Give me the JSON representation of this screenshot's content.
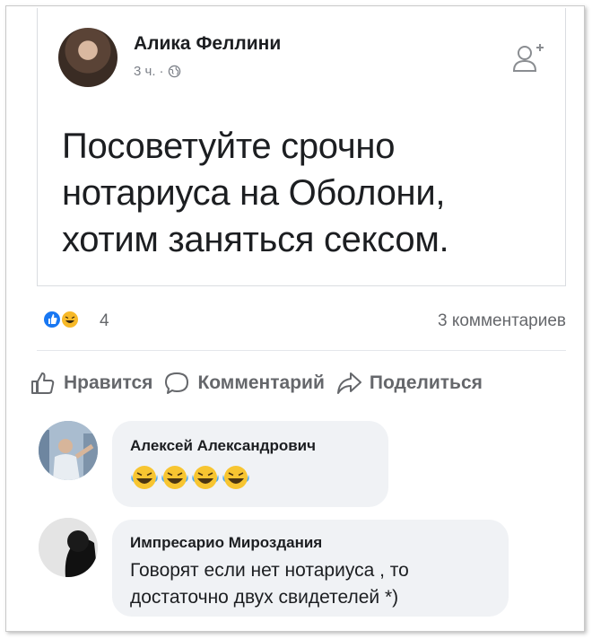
{
  "post": {
    "author": "Алика Феллини",
    "time": "3 ч.",
    "separator": "·",
    "text_lines": [
      "Посоветуйте срочно",
      "нотариуса на Оболони,",
      "хотим заняться сексом."
    ]
  },
  "reactions": {
    "count": "4",
    "comments": "3 комментариев"
  },
  "actions": {
    "like": "Нравится",
    "comment": "Комментарий",
    "share": "Поделиться"
  },
  "comments": [
    {
      "author": "Алексей Александрович",
      "emoji_count": 4
    },
    {
      "author": "Импресарио Мироздания",
      "text_lines": [
        "Говорят если нет нотариуса , то",
        "достаточно двух свидетелей *)"
      ]
    }
  ],
  "colors": {
    "like_blue": "#1877f2",
    "haha_yellow": "#f7b928",
    "muted": "#65676b",
    "bubble": "#f0f2f5"
  },
  "icons": [
    "globe-icon",
    "add-friend-icon",
    "like-reaction-icon",
    "haha-reaction-icon",
    "thumbs-up-icon",
    "comment-icon",
    "share-icon",
    "laughing-emoji-icon"
  ]
}
